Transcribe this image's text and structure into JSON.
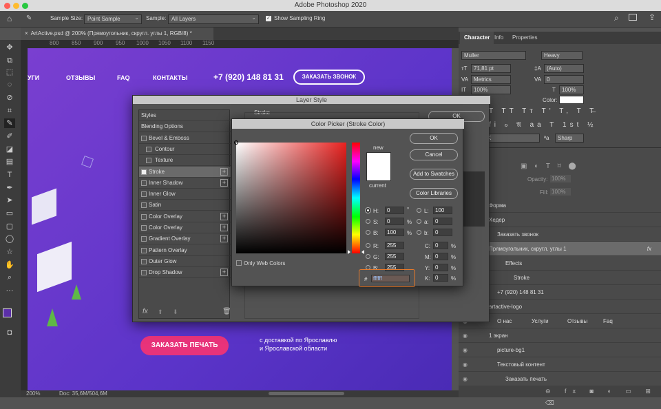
{
  "app": {
    "title": "Adobe Photoshop 2020"
  },
  "options": {
    "sample_size_label": "Sample Size:",
    "sample_size_value": "Point Sample",
    "sample_label": "Sample:",
    "sample_value": "All Layers",
    "sampling_ring_label": "Show Sampling Ring"
  },
  "doc": {
    "tab_title": "ArtActive.psd @ 200% (Прямоугольник, скругл. углы 1, RGB/8) *",
    "zoom": "200%",
    "doc_size": "Doc: 35,6M/504,6M"
  },
  "ruler": [
    "800",
    "850",
    "900",
    "950",
    "1000",
    "1050",
    "1100",
    "1150"
  ],
  "canvas": {
    "nav": [
      "УГИ",
      "ОТЗЫВЫ",
      "FAQ",
      "КОНТАКТЫ"
    ],
    "phone": "+7 (920) 148 81 31",
    "call_button": "ЗАКАЗАТЬ ЗВОНОК",
    "print_button": "ЗАКАЗАТЬ ПЕЧАТЬ",
    "delivery_line1": "с доставкой по Ярославлю",
    "delivery_line2": "и Ярославской области"
  },
  "layer_style": {
    "title": "Layer Style",
    "stroke_header": "Stroke",
    "ok": "OK",
    "items": [
      {
        "label": "Styles",
        "check": false,
        "plus": false,
        "indent": false,
        "nocheck": true
      },
      {
        "label": "Blending Options",
        "check": false,
        "plus": false,
        "indent": false,
        "nocheck": true
      },
      {
        "label": "Bevel & Emboss",
        "check": false,
        "plus": false,
        "indent": false,
        "nocheck": false
      },
      {
        "label": "Contour",
        "check": false,
        "plus": false,
        "indent": true,
        "nocheck": false
      },
      {
        "label": "Texture",
        "check": false,
        "plus": false,
        "indent": true,
        "nocheck": false
      },
      {
        "label": "Stroke",
        "check": true,
        "plus": true,
        "indent": false,
        "nocheck": false
      },
      {
        "label": "Inner Shadow",
        "check": false,
        "plus": true,
        "indent": false,
        "nocheck": false
      },
      {
        "label": "Inner Glow",
        "check": false,
        "plus": false,
        "indent": false,
        "nocheck": false
      },
      {
        "label": "Satin",
        "check": false,
        "plus": false,
        "indent": false,
        "nocheck": false
      },
      {
        "label": "Color Overlay",
        "check": false,
        "plus": true,
        "indent": false,
        "nocheck": false
      },
      {
        "label": "Color Overlay",
        "check": false,
        "plus": true,
        "indent": false,
        "nocheck": false
      },
      {
        "label": "Gradient Overlay",
        "check": false,
        "plus": true,
        "indent": false,
        "nocheck": false
      },
      {
        "label": "Pattern Overlay",
        "check": false,
        "plus": false,
        "indent": false,
        "nocheck": false
      },
      {
        "label": "Outer Glow",
        "check": false,
        "plus": false,
        "indent": false,
        "nocheck": false
      },
      {
        "label": "Drop Shadow",
        "check": false,
        "plus": true,
        "indent": false,
        "nocheck": false
      }
    ]
  },
  "color_picker": {
    "title": "Color Picker (Stroke Color)",
    "new_label": "new",
    "current_label": "current",
    "ok": "OK",
    "cancel": "Cancel",
    "add_swatches": "Add to Swatches",
    "color_libraries": "Color Libraries",
    "only_web": "Only Web Colors",
    "fields": {
      "H": "0",
      "S": "0",
      "B": "100",
      "R": "255",
      "G": "255",
      "Bv": "255",
      "L": "100",
      "a": "0",
      "b": "0",
      "C": "0",
      "M": "0",
      "Y": "0",
      "K": "0",
      "hex": "ffffff"
    },
    "units": {
      "deg": "°",
      "pct": "%"
    }
  },
  "character": {
    "tabs": [
      "Character",
      "Info",
      "Properties"
    ],
    "font": "Muller",
    "style": "Heavy",
    "size": "71,81 pt",
    "leading": "(Auto)",
    "kerning": "Metrics",
    "tracking": "0",
    "vscale": "100%",
    "hscale": "100%",
    "color_label": "Color:",
    "aa": "Sharp",
    "lang_stub": "K"
  },
  "layers": [
    {
      "name": "Форма",
      "indent": 0
    },
    {
      "name": "Хедер",
      "indent": 0
    },
    {
      "name": "Заказать звонок",
      "indent": 1
    },
    {
      "name": "Прямоугольник, скругл. углы 1",
      "indent": 0,
      "selected": true,
      "fx": "fx"
    },
    {
      "name": "Effects",
      "indent": 2
    },
    {
      "name": "Stroke",
      "indent": 3
    },
    {
      "name": "+7 (920) 148 81 31",
      "indent": 1
    },
    {
      "name": "artactive-logo",
      "indent": 0
    },
    {
      "name": "О нас",
      "indent": 1,
      "extra": [
        "Услуги",
        "Отзывы",
        "Faq"
      ]
    },
    {
      "name": "1 экран",
      "indent": 0
    },
    {
      "name": "picture-bg1",
      "indent": 1
    },
    {
      "name": "Текстовый контент",
      "indent": 1
    },
    {
      "name": "Заказать печать",
      "indent": 2
    }
  ],
  "layer_opts": {
    "opacity_label": "Opacity:",
    "opacity": "100%",
    "fill_label": "Fill:",
    "fill": "100%"
  }
}
